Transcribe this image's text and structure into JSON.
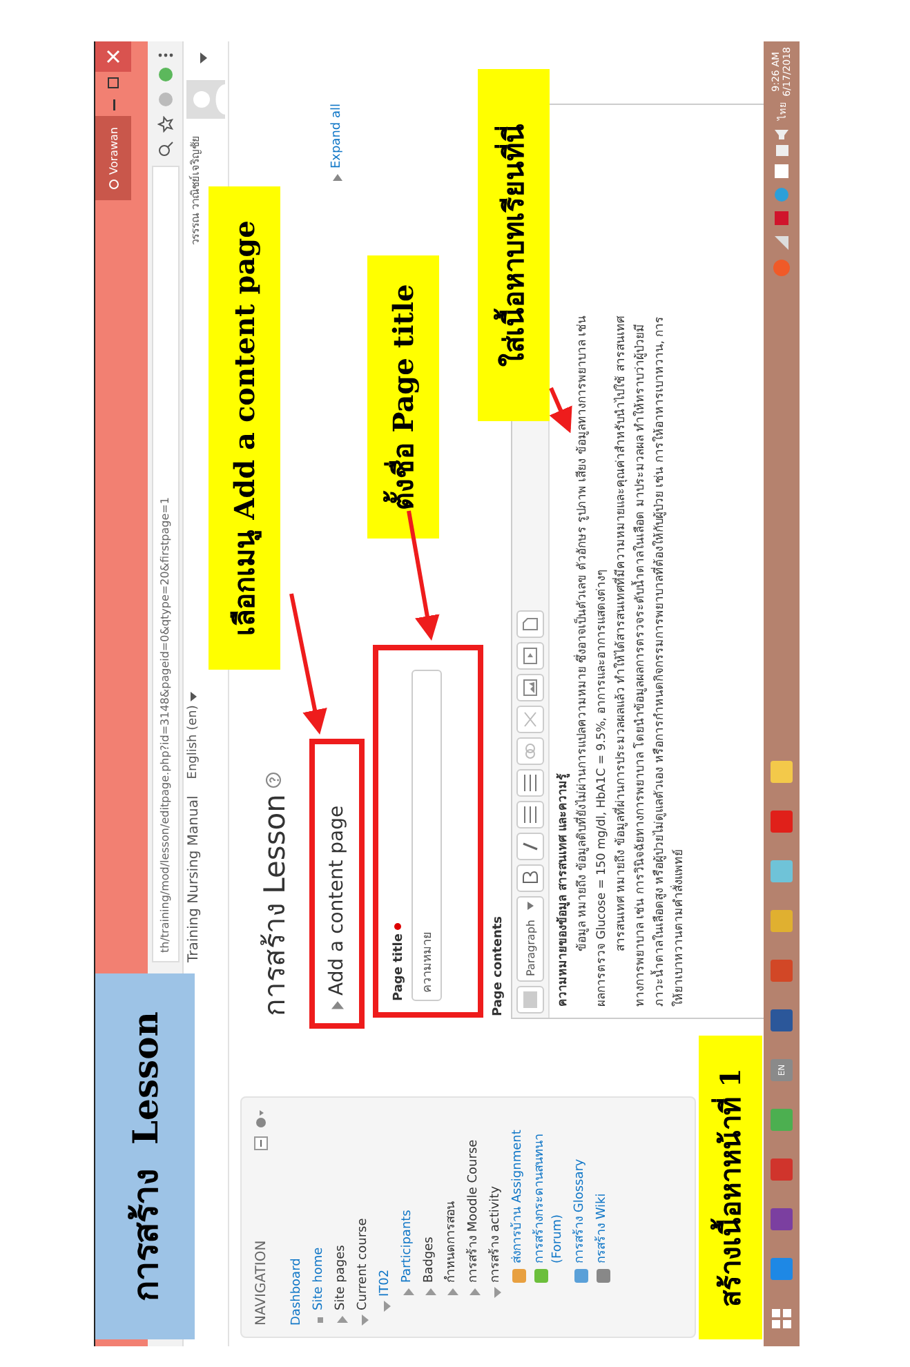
{
  "slide": {
    "title": "การสร้าง  Lesson",
    "step_label": "สร้างเนื้อหาหน้าที่ 1"
  },
  "callouts": [
    {
      "text": "เลือกเมนู Add a content page"
    },
    {
      "text": "ตั้งชื่อ Page title"
    },
    {
      "text": "ใส่เนื้อหาบทเรียนที่นี่"
    }
  ],
  "browser": {
    "profile": "Vorawan",
    "url": "th/training/mod/lesson/editpage.php?id=3148&pageid=0&qtype=20&firstpage=1"
  },
  "site_header": {
    "site_name": "Training Nursing Manual",
    "language": "English (en)",
    "user_name": "วรรรณ วาณิชย์เจริญชัย"
  },
  "navigation": {
    "title": "NAVIGATION",
    "items": [
      {
        "label": "Dashboard",
        "kind": "plain",
        "link": true
      },
      {
        "label": "Site home",
        "kind": "bullet",
        "link": true
      },
      {
        "label": "Site pages",
        "kind": "branch",
        "link": false,
        "expanded": false
      },
      {
        "label": "Current course",
        "kind": "branch",
        "link": false,
        "expanded": true,
        "children": [
          {
            "label": "IT02",
            "kind": "branch",
            "link": true,
            "expanded": true,
            "children": [
              {
                "label": "Participants",
                "kind": "branch",
                "link": true,
                "expanded": false
              },
              {
                "label": "Badges",
                "kind": "branch",
                "link": false,
                "expanded": false
              },
              {
                "label": "กำหนดการสอน",
                "kind": "branch",
                "link": false,
                "expanded": false
              },
              {
                "label": "การสร้าง Moodle Course",
                "kind": "branch",
                "link": false,
                "expanded": false
              },
              {
                "label": "การสร้าง activity",
                "kind": "branch",
                "link": false,
                "expanded": true,
                "children": [
                  {
                    "label": "ส่งการบ้าน Assignment",
                    "kind": "assignment",
                    "link": true
                  },
                  {
                    "label": "การสร้างกระดานสนทนา (Forum)",
                    "kind": "forum",
                    "link": true
                  },
                  {
                    "label": "การสร้าง Glossary",
                    "kind": "glossary",
                    "link": true
                  },
                  {
                    "label": "กรสร้าง Wiki",
                    "kind": "wiki",
                    "link": true
                  }
                ]
              }
            ]
          }
        ]
      }
    ]
  },
  "main": {
    "heading": "การสร้าง Lesson",
    "section": {
      "label": "Add a content page",
      "expanded": false
    },
    "expand_all": "Expand all",
    "page_title": {
      "label": "Page title",
      "required": true,
      "value": "ความหมาย"
    },
    "page_contents": {
      "label": "Page contents",
      "format": "Paragraph",
      "lines": [
        {
          "text": "ความหมายของข้อมูล สารสนเทศ และความรู้",
          "kind": "heading"
        },
        {
          "text": "ข้อมูล หมายถึง ข้อมูลดิบที่ยังไม่ผ่านการแปลความหมาย ซึ่งอาจเป็นตัวเลข ตัวอักษร รูปภาพ เสียง ข้อมูลทางการพยาบาล เช่น",
          "kind": "indent"
        },
        {
          "text": "ผลการตรวจ  Glucose = 150 mg/dl,  HbA1C = 9.5%, อาการและอาการแสดงต่างๆ",
          "kind": "plain"
        },
        {
          "text": "สารสนเทศ หมายถึง ข้อมูลที่ผ่านการประมวลผลแล้ว ทำให้ได้สารสนเทศที่มีความหมายและคุณค่าสำหรับนำไปใช้ สารสนเทศ",
          "kind": "indent"
        },
        {
          "text": "ทางการพยาบาล เช่น การวินิจฉัยทางการพยาบาล โดยนำข้อมูลผลการตรวจระดับน้ำตาลในเลือด มาประมวลผล ทำให้ทราบว่าผู้ป่วยมี",
          "kind": "plain"
        },
        {
          "text": "ภาวะน้ำตาลในเลือดสูง หรือผู้ป่วยไม่ดูแลตัวเอง หรือการกำหนดกิจกรรมการพยาบาลที่ต้องให้กับผู้ป่วย เช่น การให้อาหารเบาหวาน, การ",
          "kind": "plain"
        },
        {
          "text": "ให้ยาเบาหวานตามคำสั่งแพทย์",
          "kind": "plain"
        }
      ]
    }
  },
  "taskbar": {
    "apps": [
      {
        "kind": "start"
      },
      {
        "kind": "ie"
      },
      {
        "kind": "onenote"
      },
      {
        "kind": "photos"
      },
      {
        "kind": "chrome"
      },
      {
        "kind": "keyboard",
        "label": "EN"
      },
      {
        "kind": "word"
      },
      {
        "kind": "powerpoint"
      },
      {
        "kind": "lock"
      },
      {
        "kind": "cube"
      },
      {
        "kind": "acrobat"
      },
      {
        "kind": "calendar"
      }
    ],
    "language": "ไทย",
    "time": "9:26 AM",
    "date": "6/17/2018"
  }
}
